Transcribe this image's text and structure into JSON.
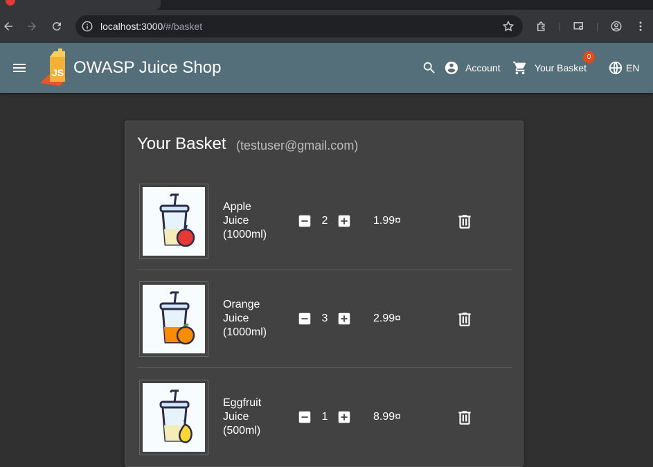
{
  "browser": {
    "url_host": "localhost:3000",
    "url_path": "/#/basket"
  },
  "app": {
    "title": "OWASP Juice Shop",
    "account_label": "Account",
    "basket_label": "Your Basket",
    "basket_count": "0",
    "language_label": "EN"
  },
  "basket": {
    "title": "Your Basket",
    "email": "(testuser@gmail.com)",
    "items": [
      {
        "name": "Apple Juice (1000ml)",
        "quantity": "2",
        "price": "1.99¤",
        "fruit": "apple",
        "fruit_color": "#e53935"
      },
      {
        "name": "Orange Juice (1000ml)",
        "quantity": "3",
        "price": "2.99¤",
        "fruit": "orange",
        "fruit_color": "#fb8c00"
      },
      {
        "name": "Eggfruit Juice (500ml)",
        "quantity": "1",
        "price": "8.99¤",
        "fruit": "eggfruit",
        "fruit_color": "#fdd835"
      }
    ]
  },
  "colors": {
    "header": "#546e7a",
    "background": "#303030",
    "card": "#424242",
    "badge": "#e64a19"
  }
}
